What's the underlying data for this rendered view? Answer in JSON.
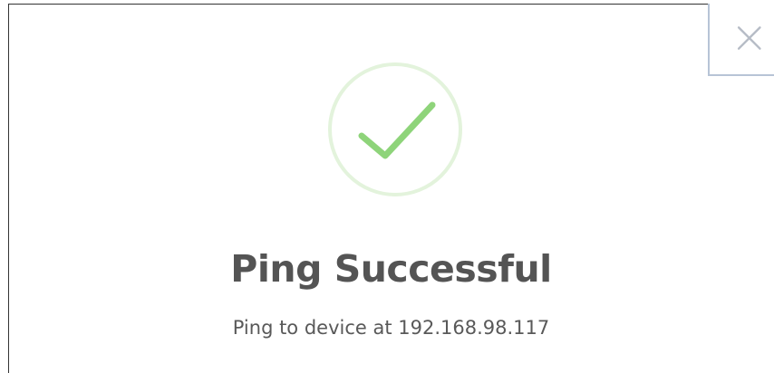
{
  "dialog": {
    "title": "Ping Successful",
    "message": "Ping to device at 192.168.98.117",
    "close_icon": "close-icon",
    "status_icon": "success-checkmark-icon"
  },
  "colors": {
    "success_ring": "#e3f3dc",
    "success_check": "#8ed47a",
    "title_text": "#545454",
    "message_text": "#595959",
    "close_border": "#b7c4d6",
    "close_icon": "#b6bcc6"
  }
}
